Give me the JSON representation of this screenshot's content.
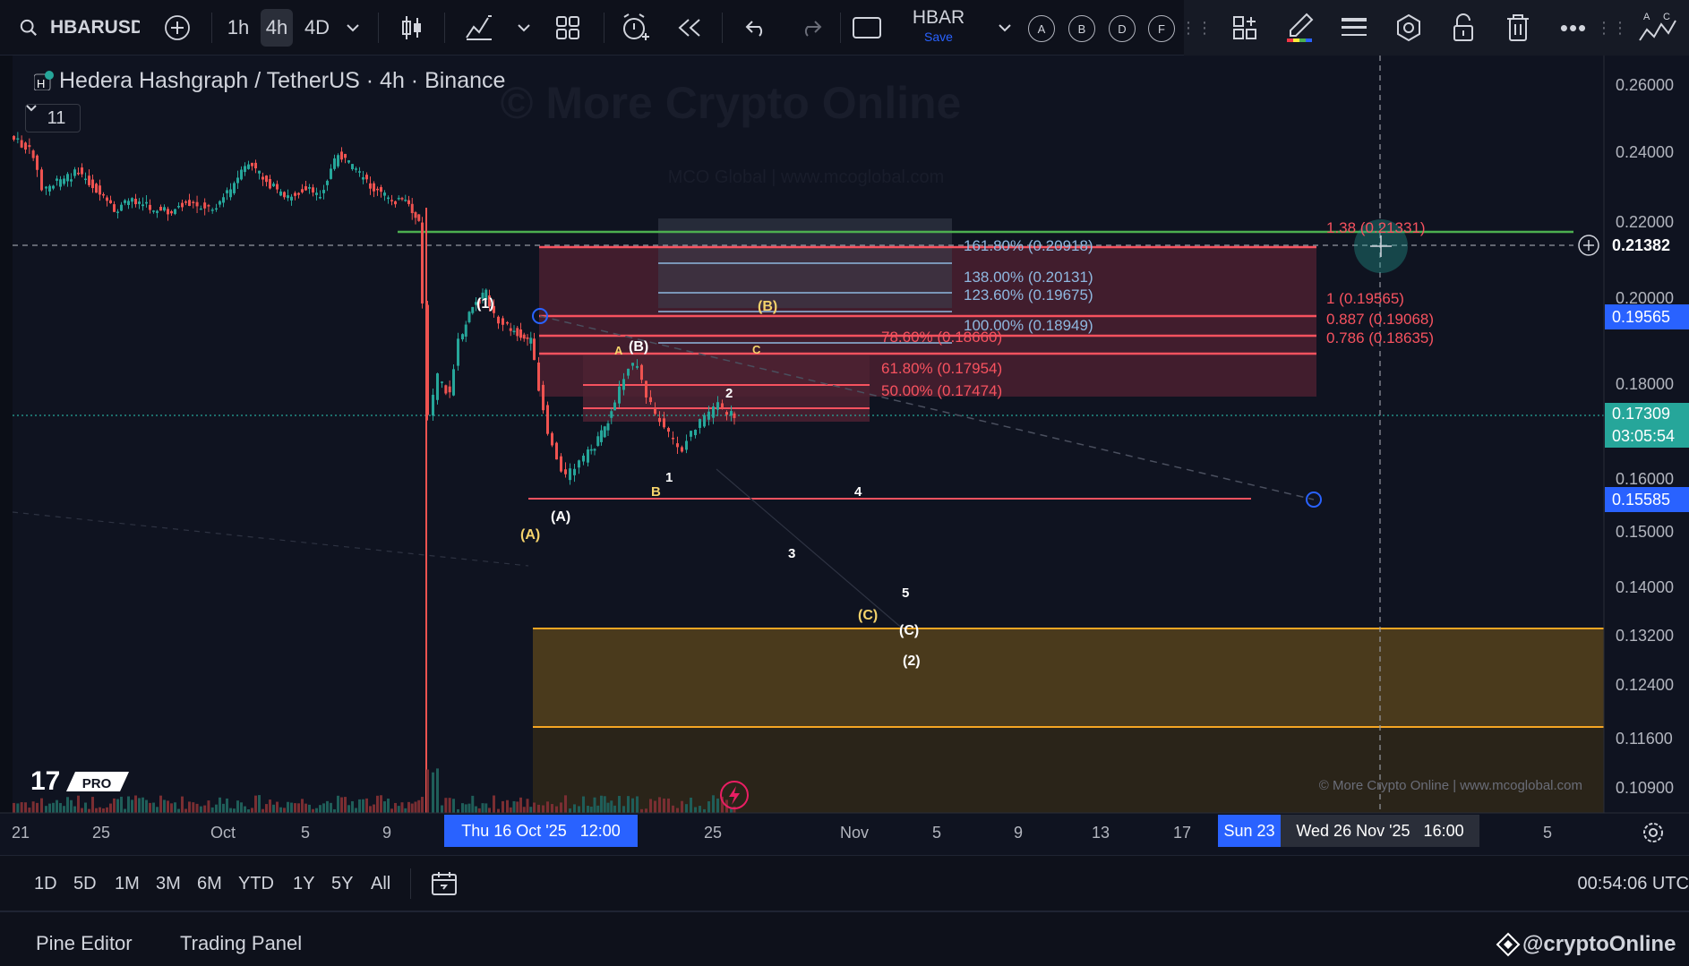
{
  "toolbar": {
    "symbol": "HBARUSD",
    "intervals": [
      "1h",
      "4h",
      "4D"
    ],
    "active_interval": "4h",
    "layout_name": "HBAR",
    "layout_save": "Save",
    "drawing_letters": [
      "A",
      "B",
      "D",
      "F"
    ]
  },
  "chart": {
    "title": "Hedera Hashgraph / TetherUS · 4h · Binance",
    "indicator_count": "11",
    "watermark_main": "© More Crypto Online",
    "watermark_sub": "MCO Global  |  www.mcoglobal.com",
    "footer_watermark": "© More Crypto Online  |  www.mcoglobal.com",
    "tv_badge": "PRO"
  },
  "price_axis": {
    "ticks": [
      "0.26000",
      "0.24000",
      "0.22000",
      "0.20000",
      "0.18000",
      "0.16000",
      "0.15000",
      "0.14000",
      "0.13200",
      "0.12400",
      "0.11600",
      "0.10900"
    ],
    "crosshair_price": "0.21382",
    "label_blue_top": "0.19565",
    "current_price": "0.17309",
    "countdown": "03:05:54",
    "label_blue_bottom": "0.15585"
  },
  "time_axis": {
    "ticks": [
      "21",
      "25",
      "Oct",
      "5",
      "9",
      "25",
      "Nov",
      "5",
      "9",
      "13",
      "17",
      "5"
    ],
    "highlight_left": "Thu 16 Oct '25   12:00",
    "highlight_right_start": "Sun 23",
    "crosshair_time": "Wed 26 Nov '25   16:00"
  },
  "fib_left": [
    {
      "label": "161.80% (0.20918)"
    },
    {
      "label": "138.00% (0.20131)"
    },
    {
      "label": "123.60% (0.19675)"
    },
    {
      "label": "100.00% (0.18949)"
    },
    {
      "label": "78.60% (0.18660)"
    },
    {
      "label": "61.80% (0.17954)"
    },
    {
      "label": "50.00% (0.17474)"
    }
  ],
  "fib_right": [
    {
      "label": "1.38 (0.21331)"
    },
    {
      "label": "1 (0.19565)"
    },
    {
      "label": "0.887 (0.19068)"
    },
    {
      "label": "0.786 (0.18635)"
    }
  ],
  "wave_labels": {
    "w1": "(1)",
    "wA_paren": "(A)",
    "wA_yellow": "(A)",
    "wB_yellow": "(B)",
    "wB_white": "(B)",
    "a": "A",
    "c": "C",
    "b": "B",
    "n1": "1",
    "n2": "2",
    "n3": "3",
    "n4": "4",
    "n5": "5",
    "wC_yellow": "(C)",
    "wC_white": "(C)",
    "w2": "(2)"
  },
  "ranges": [
    "1D",
    "5D",
    "1M",
    "3M",
    "6M",
    "YTD",
    "1Y",
    "5Y",
    "All"
  ],
  "clock": "00:54:06 UTC",
  "footer": {
    "tab1": "Pine Editor",
    "tab2": "Trading Panel",
    "brand": "@cryptoOnline"
  },
  "colors": {
    "background": "#0f1320",
    "up": "#26a69a",
    "down": "#ef5350",
    "blue_label": "#2962ff",
    "current_label": "#26a69a",
    "green_line": "#4caf50",
    "orange_zone": "#f5a623"
  }
}
